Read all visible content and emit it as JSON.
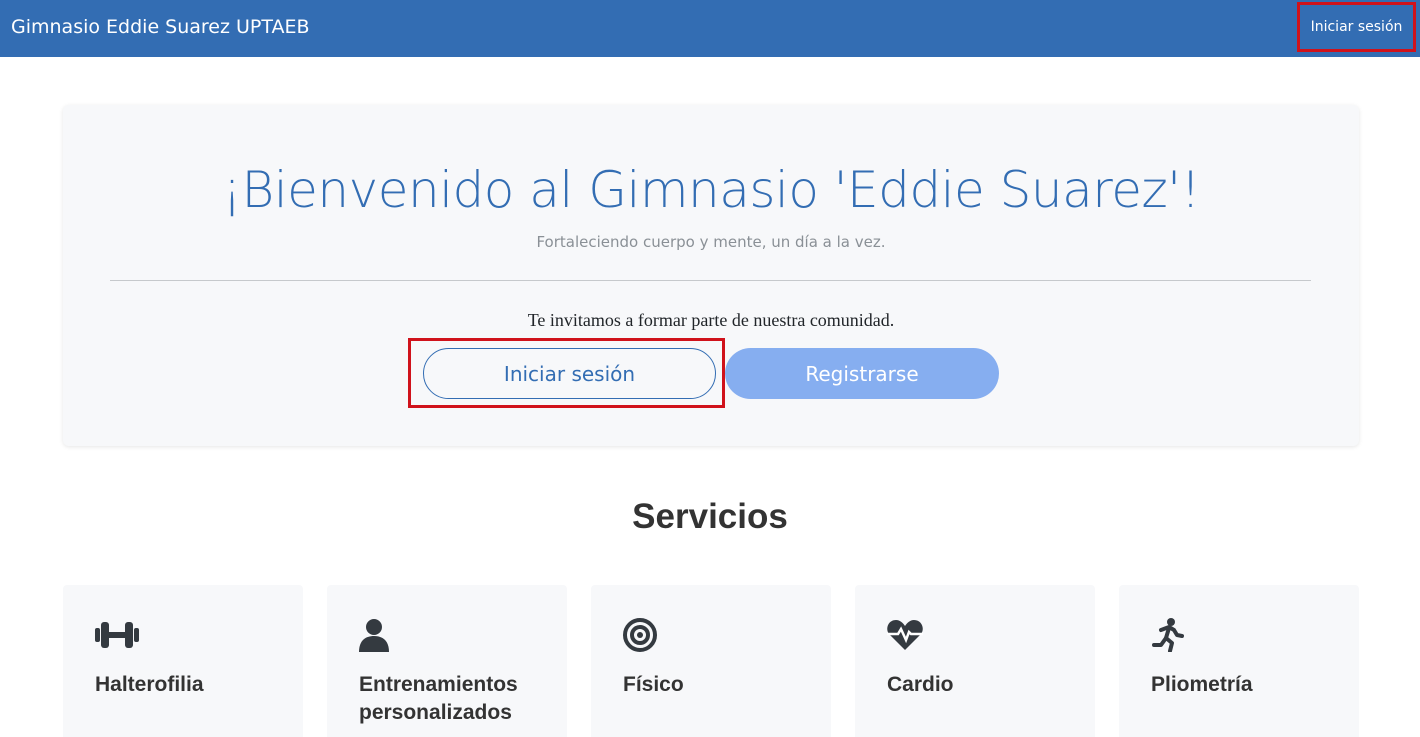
{
  "navbar": {
    "brand": "Gimnasio Eddie Suarez UPTAEB",
    "login_label": "Iniciar sesión"
  },
  "hero": {
    "title": "¡Bienvenido al Gimnasio 'Eddie Suarez'!",
    "subtitle": "Fortaleciendo cuerpo y mente, un día a la vez.",
    "invite": "Te invitamos a formar parte de nuestra comunidad.",
    "login_button": "Iniciar sesión",
    "register_button": "Registrarse"
  },
  "services": {
    "title": "Servicios",
    "items": [
      {
        "label": "Halterofilia",
        "icon": "dumbbell-icon"
      },
      {
        "label": "Entrenamientos personalizados",
        "icon": "user-icon"
      },
      {
        "label": "Físico",
        "icon": "target-icon"
      },
      {
        "label": "Cardio",
        "icon": "heart-pulse-icon"
      },
      {
        "label": "Pliometría",
        "icon": "running-icon"
      }
    ]
  },
  "colors": {
    "primary": "#336db3",
    "register_button": "#86aef0",
    "highlight": "#d0121b",
    "card_background": "#f7f8fa",
    "icon": "#343a40"
  }
}
